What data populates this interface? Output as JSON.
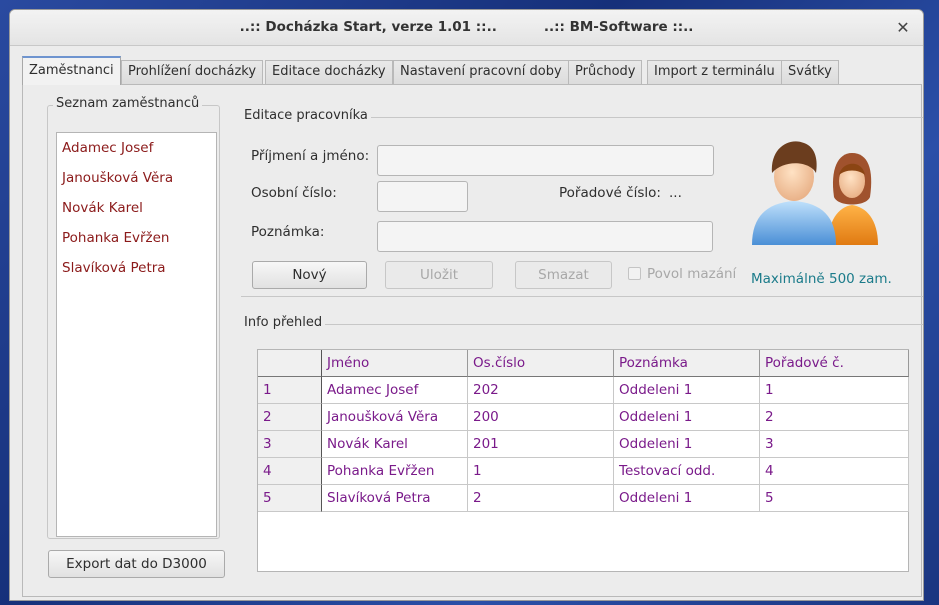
{
  "window": {
    "title": "..:: Docházka Start, verze 1.01 ::..          ..:: BM-Software ::..",
    "close_glyph": "✕"
  },
  "tabs": [
    {
      "label": "Zaměstnanci",
      "active": true
    },
    {
      "label": "Prohlížení docházky"
    },
    {
      "label": "Editace docházky"
    },
    {
      "label": "Nastavení pracovní doby"
    },
    {
      "label": "Průchody"
    },
    {
      "label": "Import z terminálu"
    },
    {
      "label": "Svátky"
    }
  ],
  "employee_list": {
    "title": "Seznam zaměstnanců",
    "items": [
      "Adamec Josef",
      "Janoušková Věra",
      "Novák Karel",
      "Pohanka Evřžen",
      "Slavíková Petra"
    ]
  },
  "export_button": "Export dat do D3000",
  "edit": {
    "title": "Editace pracovníka",
    "name_label": "Příjmení a jméno:",
    "name_value": "",
    "personal_number_label": "Osobní číslo:",
    "personal_number_value": "",
    "order_number_label": "Pořadové číslo:",
    "order_number_value": "...",
    "note_label": "Poznámka:",
    "note_value": "",
    "new_button": "Nový",
    "save_button": "Uložit",
    "delete_button": "Smazat",
    "allow_delete_label": "Povol mazání",
    "max_note": "Maximálně 500 zam."
  },
  "info": {
    "title": "Info přehled",
    "columns": [
      "",
      "Jméno",
      "Os.číslo",
      "Poznámka",
      "Pořadové č."
    ],
    "rows": [
      [
        "1",
        "Adamec Josef",
        "202",
        "Oddeleni 1",
        "1"
      ],
      [
        "2",
        "Janoušková Věra",
        "200",
        "Oddeleni 1",
        "2"
      ],
      [
        "3",
        "Novák Karel",
        "201",
        "Oddeleni 1",
        "3"
      ],
      [
        "4",
        "Pohanka Evřžen",
        "1",
        "Testovací odd.",
        "4"
      ],
      [
        "5",
        "Slavíková Petra",
        "2",
        "Oddeleni 1",
        "5"
      ]
    ]
  },
  "colors": {
    "employee_text": "#8b1a1a",
    "grid_text": "#7a1a8a",
    "max_note": "#1b7b8a",
    "active_tab_accent": "#6e94cf"
  },
  "icons": {
    "users": "users-icon",
    "close": "close-icon"
  }
}
